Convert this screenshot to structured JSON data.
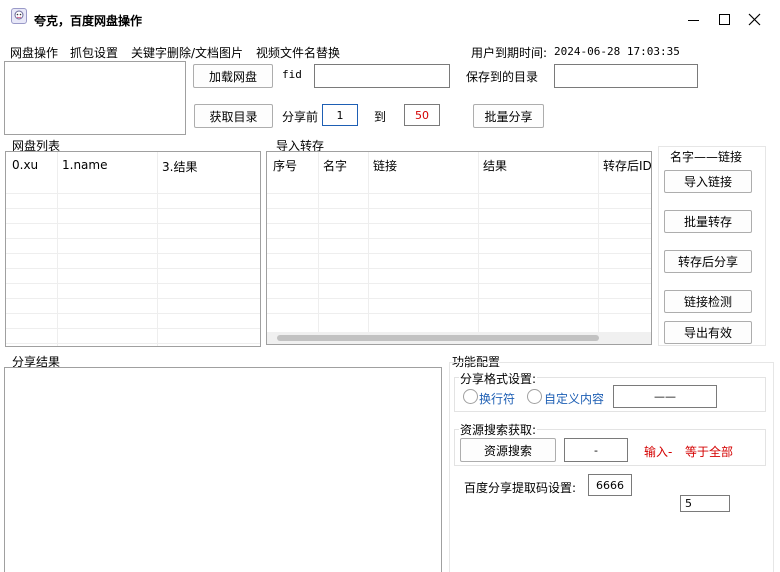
{
  "window": {
    "title": "夸克，百度网盘操作"
  },
  "menu": [
    "网盘操作",
    "抓包设置",
    "关键字删除/文档图片",
    "视频文件名替换"
  ],
  "expire": {
    "label": "用户到期时间:",
    "value": "2024-06-28 17:03:35"
  },
  "top": {
    "load_btn": "加载网盘",
    "fid_label": "fid",
    "fid_value": "",
    "save_dir_label": "保存到的目录",
    "save_dir_value": "",
    "get_dir_btn": "获取目录",
    "share_before_label": "分享前",
    "share_from": "1",
    "to_label": "到",
    "share_to": "50",
    "batch_share_btn": "批量分享"
  },
  "pan_list": {
    "title": "网盘列表",
    "columns": [
      "0.xu",
      "1.name",
      "3.结果"
    ]
  },
  "import": {
    "title": "导入转存",
    "columns": [
      "序号",
      "名字",
      "链接",
      "结果",
      "转存后ID"
    ]
  },
  "name_link": {
    "title": "名字——链接",
    "buttons": [
      "导入链接",
      "批量转存",
      "转存后分享",
      "链接检测",
      "导出有效"
    ]
  },
  "share_result": {
    "title": "分享结果"
  },
  "config": {
    "title": "功能配置",
    "format_title": "分享格式设置:",
    "radio_newline": "换行符",
    "radio_custom": "自定义内容",
    "custom_value": "——",
    "search_title": "资源搜索获取:",
    "search_btn": "资源搜索",
    "search_value": "-",
    "hint_input": "输入-",
    "hint_all": "等于全部",
    "code_label": "百度分享提取码设置:",
    "code_value": "6666",
    "extra_value": "5"
  },
  "colors": {
    "accent_blue": "#1e5fb4",
    "red_text": "#d40000"
  }
}
